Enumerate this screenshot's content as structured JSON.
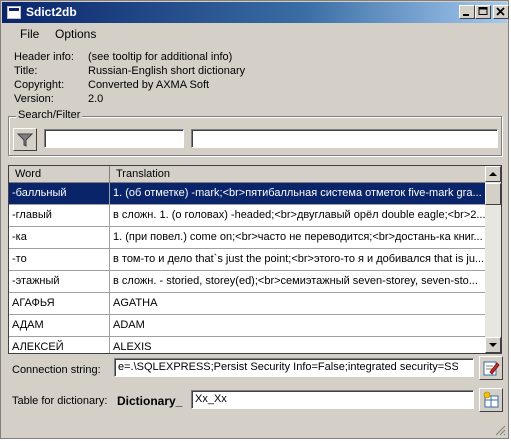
{
  "window": {
    "title": "Sdict2db"
  },
  "menu": {
    "file": "File",
    "options": "Options"
  },
  "header_info": {
    "header_label": "Header  info:",
    "header_value": "(see tooltip for additional info)",
    "title_label": "Title:",
    "title_value": "Russian-English short dictionary",
    "copyright_label": "Copyright:",
    "copyright_value": "Converted by AXMA Soft",
    "version_label": "Version:",
    "version_value": "2.0"
  },
  "search": {
    "group_label": "Search/Filter",
    "field1_value": "",
    "field2_value": ""
  },
  "grid": {
    "columns": [
      "Word",
      "Translation"
    ],
    "rows": [
      {
        "word": "-балльный",
        "translation": "1. (об отметке) -mark;<br>пятибалльная система отметок five-mark gra..."
      },
      {
        "word": "-главый",
        "translation": "в сложн. 1. (о головах) -headed;<br>двуглавый орёл double eagle;<br>2...."
      },
      {
        "word": "-ка",
        "translation": "1. (при повел.) come on;<br>часто не переводится;<br>достань-ка книг..."
      },
      {
        "word": "-то",
        "translation": "в том-то и дело that`s just the point;<br>этого-то я и добивался that is ju..."
      },
      {
        "word": "-этажный",
        "translation": "в сложн. - storied, storey(ed);<br>семиэтажный seven-storey, seven-sto..."
      },
      {
        "word": "АГАФЬЯ",
        "translation": "AGATHA"
      },
      {
        "word": "АДАМ",
        "translation": "ADAM"
      },
      {
        "word": "АЛЕКСЕЙ",
        "translation": "ALEXIS"
      }
    ],
    "selected_row": 0
  },
  "connection": {
    "label": "Connection string:",
    "value": "e=.\\SQLEXPRESS;Persist Security Info=False;integrated security=SSPI"
  },
  "table": {
    "label": "Table for dictionary:",
    "prefix": "Dictionary_",
    "value": "Xx_Xx"
  },
  "colors": {
    "selection": "#0a246a",
    "face": "#d4d0c8",
    "title_start": "#0a246a",
    "title_end": "#a6caf0"
  }
}
